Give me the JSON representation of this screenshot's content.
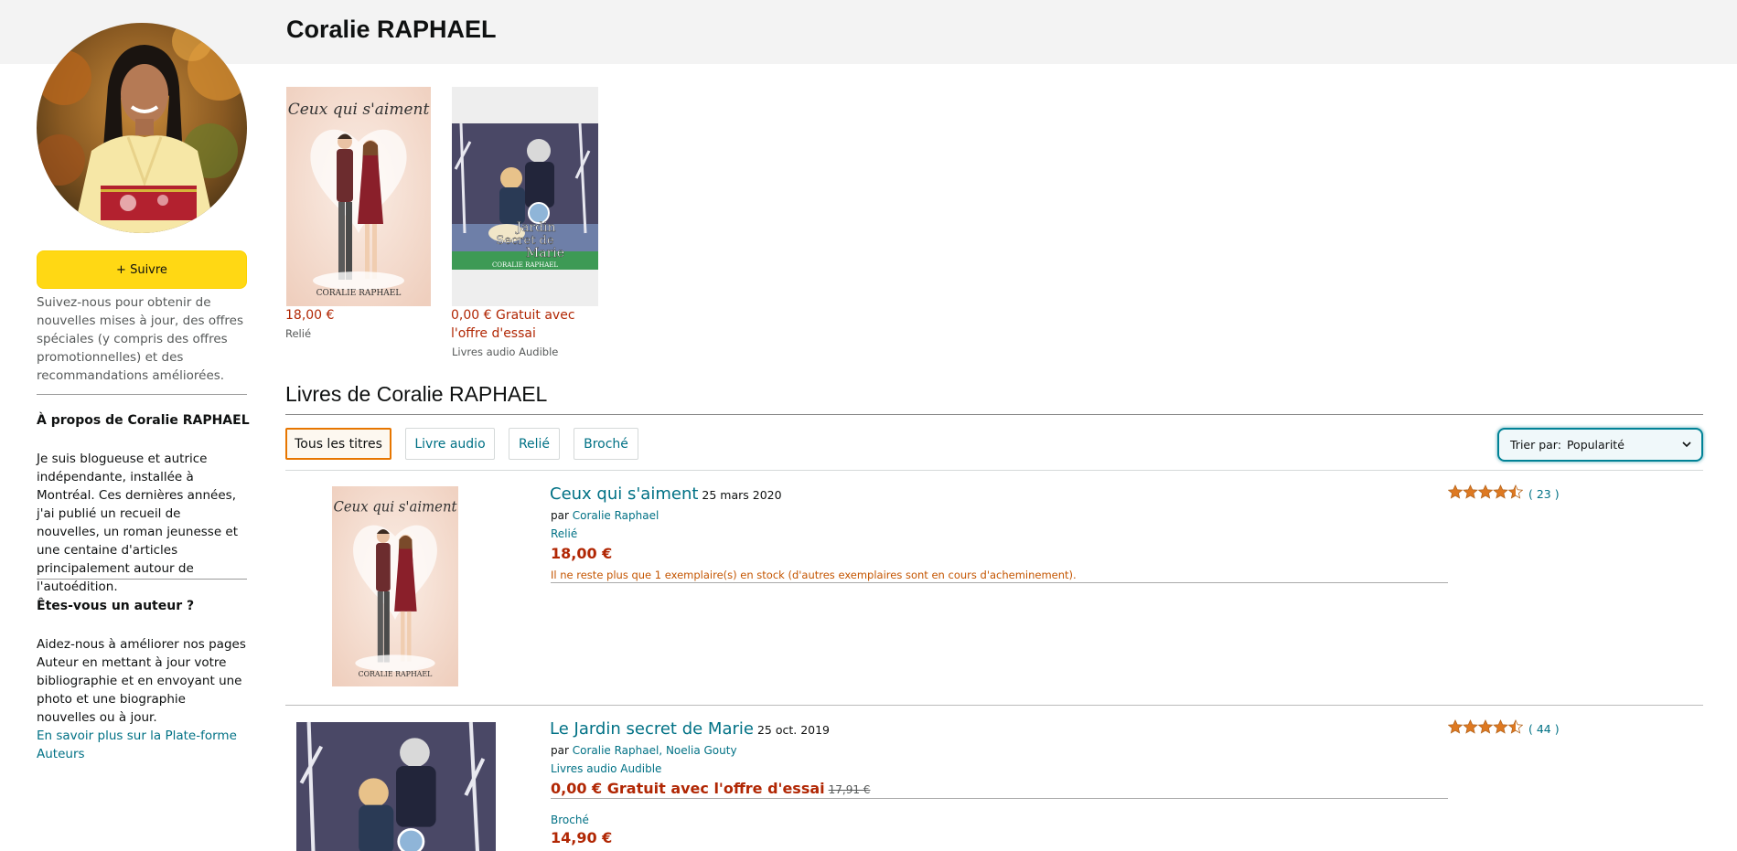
{
  "header": {
    "author_name": "Coralie RAPHAEL"
  },
  "sidebar": {
    "follow_label": "+ Suivre",
    "follow_description": "Suivez-nous pour obtenir de nouvelles mises à jour, des offres spéciales (y compris des offres promotionnelles) et des recommandations améliorées.",
    "about_heading": "À propos de Coralie RAPHAEL",
    "about_text": "Je suis blogueuse et autrice indépendante, installée à Montréal. Ces dernières années, j'ai publié un recueil de nouvelles, un roman jeunesse et une centaine d'articles principalement autour de l'autoédition.",
    "author_heading": "Êtes-vous un auteur ?",
    "author_text": "Aidez-nous à améliorer nos pages Auteur en mettant à jour votre bibliographie et en envoyant une photo et une biographie nouvelles ou à jour.",
    "author_link": "En savoir plus sur la Plate-forme Auteurs"
  },
  "featured": [
    {
      "price": "18,00 €",
      "format": "Relié",
      "cover_title": "Ceux qui s'aiment",
      "cover_author": "CORALIE RAPHAEL"
    },
    {
      "price": "0,00 € Gratuit avec l'offre d'essai",
      "format": "Livres audio Audible",
      "cover_title_1": "Jardin",
      "cover_title_2": "Secret de",
      "cover_title_3": "Marie",
      "cover_author": "CORALIE RAPHAEL"
    }
  ],
  "books_section": {
    "heading": "Livres de Coralie RAPHAEL",
    "filters": [
      "Tous les titres",
      "Livre audio",
      "Relié",
      "Broché"
    ],
    "sort_label": "Trier par:",
    "sort_value": "Popularité"
  },
  "books": [
    {
      "title": "Ceux qui s'aiment",
      "date": "25 mars 2020",
      "by_prefix": "par",
      "authors": "Coralie Raphael",
      "format": "Relié",
      "price": "18,00 €",
      "stock": "Il ne reste plus que 1 exemplaire(s) en stock (d'autres exemplaires sont en cours d'acheminement).",
      "rating": 4.5,
      "rating_count": "( 23 )"
    },
    {
      "title": "Le Jardin secret de Marie",
      "date": "25 oct. 2019",
      "by_prefix": "par",
      "authors": "Coralie Raphael, Noelia Gouty",
      "format": "Livres audio Audible",
      "price": "0,00 € Gratuit avec l'offre d'essai",
      "old_price": "17,91 €",
      "format2": "Broché",
      "price2": "14,90 €",
      "rating": 4.5,
      "rating_count": "( 44 )"
    }
  ],
  "colors": {
    "price": "#b12704",
    "link": "#007185",
    "follow": "#ffd814",
    "active_filter": "#e77600",
    "star": "#de7921"
  }
}
